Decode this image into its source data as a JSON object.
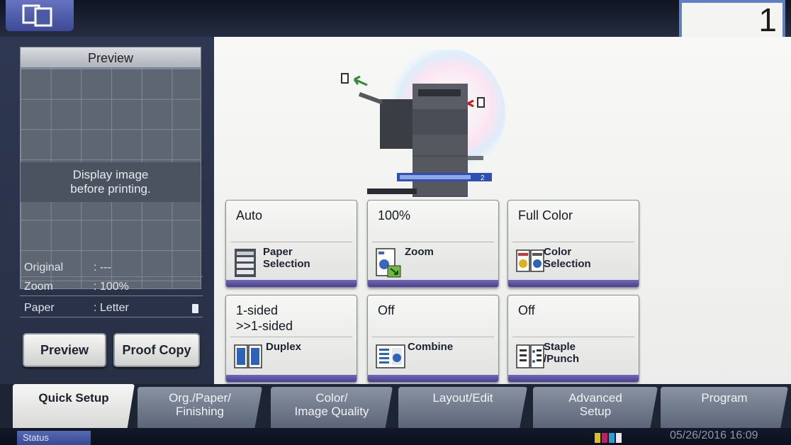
{
  "copies": {
    "count": "1"
  },
  "preview": {
    "title": "Preview",
    "message": "Display image\nbefore printing.",
    "rows": [
      {
        "label": "Original",
        "value": ": ---"
      },
      {
        "label": "Zoom",
        "value": ": 100%"
      },
      {
        "label": "Paper",
        "value": ": Letter"
      }
    ],
    "preview_button": "Preview",
    "proof_copy_button": "Proof Copy"
  },
  "machine": {
    "tray_number": "2"
  },
  "functions": [
    {
      "value": "Auto",
      "name": "Paper\nSelection",
      "icon": "paper-selection-icon"
    },
    {
      "value": "100%",
      "name": "Zoom",
      "icon": "zoom-icon"
    },
    {
      "value": "Full Color",
      "name": "Color\nSelection",
      "icon": "color-selection-icon"
    },
    {
      "value": "1-sided\n>>1-sided",
      "name": "Duplex",
      "icon": "duplex-icon"
    },
    {
      "value": "Off",
      "name": "Combine",
      "icon": "combine-icon"
    },
    {
      "value": "Off",
      "name": "Staple\n/Punch",
      "icon": "staple-punch-icon"
    }
  ],
  "tabs": [
    {
      "label": "Quick Setup",
      "active": true
    },
    {
      "label": "Org./Paper/\nFinishing",
      "active": false
    },
    {
      "label": "Color/\nImage Quality",
      "active": false
    },
    {
      "label": "Layout/Edit",
      "active": false
    },
    {
      "label": "Advanced\nSetup",
      "active": false
    },
    {
      "label": "Program",
      "active": false
    }
  ],
  "status": {
    "button_label": "Status",
    "datetime": "05/26/2016 16:09",
    "toner_colors": [
      "#d8c020",
      "#c02060",
      "#2aa0d0",
      "#e8e8e8"
    ]
  }
}
